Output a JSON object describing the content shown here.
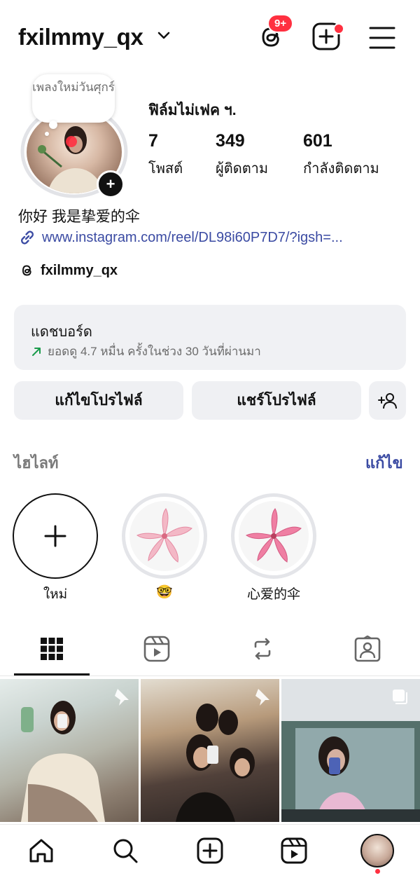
{
  "header": {
    "username": "fxilmmy_qx",
    "threads_badge": "9+"
  },
  "profile": {
    "note": "เพลงใหม่วันศุกร์",
    "display_name": "ฟิล์มไม่เฟค ฯ.",
    "stats": [
      {
        "value": "7",
        "label": "โพสต์"
      },
      {
        "value": "349",
        "label": "ผู้ติดตาม"
      },
      {
        "value": "601",
        "label": "กำลังติดตาม"
      }
    ],
    "bio": "你好 我是挚爱的伞",
    "link": "www.instagram.com/reel/DL98i60P7D7/?igsh=...",
    "threads_handle": "fxilmmy_qx"
  },
  "dashboard": {
    "title": "แดชบอร์ด",
    "subtitle": "ยอดดู 4.7 หมื่น ครั้งในช่วง 30 วันที่ผ่านมา"
  },
  "actions": {
    "edit_profile": "แก้ไขโปรไฟล์",
    "share_profile": "แชร์โปรไฟล์"
  },
  "highlights": {
    "title": "ไฮไลท์",
    "edit": "แก้ไข",
    "items": [
      {
        "label": "ใหม่"
      },
      {
        "label": "🤓"
      },
      {
        "label": "心爱的伞"
      }
    ]
  },
  "tabs": [
    "grid-icon",
    "reels-icon",
    "reposts-icon",
    "tagged-icon"
  ],
  "colors": {
    "accent_link": "#3b4ba3",
    "badge_red": "#ff3040",
    "trend_green": "#1a9b4b"
  }
}
